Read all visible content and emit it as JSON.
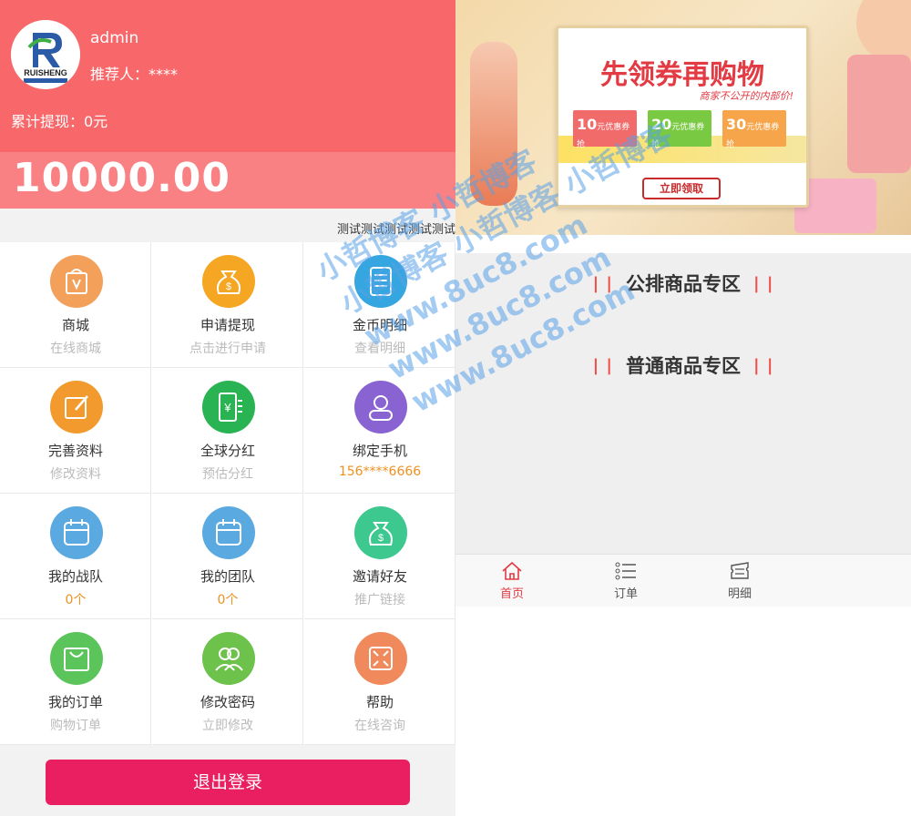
{
  "profile": {
    "username": "admin",
    "referrer": "推荐人：****",
    "total_withdrawn": "累计提现：0元",
    "balance": "10000.00",
    "logo_text": "RUISHENG"
  },
  "announcement": "测试测试测试测试测试",
  "menu": [
    {
      "title": "商城",
      "sub": "在线商城",
      "icon": "shopping-bag-icon",
      "color": "#f2a05a"
    },
    {
      "title": "申请提现",
      "sub": "点击进行申请",
      "icon": "money-bag-icon",
      "color": "#f5a623"
    },
    {
      "title": "金币明细",
      "sub": "查看明细",
      "icon": "document-icon",
      "color": "#35a6e0"
    },
    {
      "title": "完善资料",
      "sub": "修改资料",
      "icon": "edit-icon",
      "color": "#f29a2e"
    },
    {
      "title": "全球分红",
      "sub": "预估分红",
      "icon": "yuan-phone-icon",
      "color": "#2ab352"
    },
    {
      "title": "绑定手机",
      "sub": "156****6666",
      "icon": "user-badge-icon",
      "color": "#8a63d2"
    },
    {
      "title": "我的战队",
      "sub": "0个",
      "icon": "calendar-icon",
      "color": "#5aa9e0"
    },
    {
      "title": "我的团队",
      "sub": "0个",
      "icon": "calendar-icon",
      "color": "#5aa9e0"
    },
    {
      "title": "邀请好友",
      "sub": "推广链接",
      "icon": "money-bag-icon",
      "color": "#3cc88e"
    },
    {
      "title": "我的订单",
      "sub": "购物订单",
      "icon": "bag-icon",
      "color": "#5bc45a"
    },
    {
      "title": "修改密码",
      "sub": "立即修改",
      "icon": "users-icon",
      "color": "#6cc24a"
    },
    {
      "title": "帮助",
      "sub": "在线咨询",
      "icon": "expand-icon",
      "color": "#f08a5d"
    }
  ],
  "logout_label": "退出登录",
  "banner": {
    "headline": "先领券再购物",
    "tagline": "商家不公开的内部价!",
    "coupons": [
      {
        "amount": "10",
        "label": "元优惠券",
        "action": "抢",
        "color": "#f26b6b"
      },
      {
        "amount": "20",
        "label": "元优惠券",
        "action": "抢",
        "color": "#7ac943"
      },
      {
        "amount": "30",
        "label": "元优惠券",
        "action": "抢",
        "color": "#f7a54a"
      }
    ],
    "cta": "立即领取"
  },
  "zones": [
    {
      "label": "公排商品专区"
    },
    {
      "label": "普通商品专区"
    }
  ],
  "tabs": [
    {
      "label": "首页",
      "icon": "home-icon",
      "active": true
    },
    {
      "label": "订单",
      "icon": "list-icon",
      "active": false
    },
    {
      "label": "明细",
      "icon": "ticket-icon",
      "active": false
    }
  ],
  "watermark": [
    "小哲博客 小哲博客",
    "小哲博客 小哲博客 小哲博客",
    "www.8uc8.com",
    "www.8uc8.com",
    "www.8uc8.com"
  ],
  "colors": {
    "header": "#f8676a",
    "accent": "#ea1f62",
    "active_tab": "#e23b44"
  }
}
